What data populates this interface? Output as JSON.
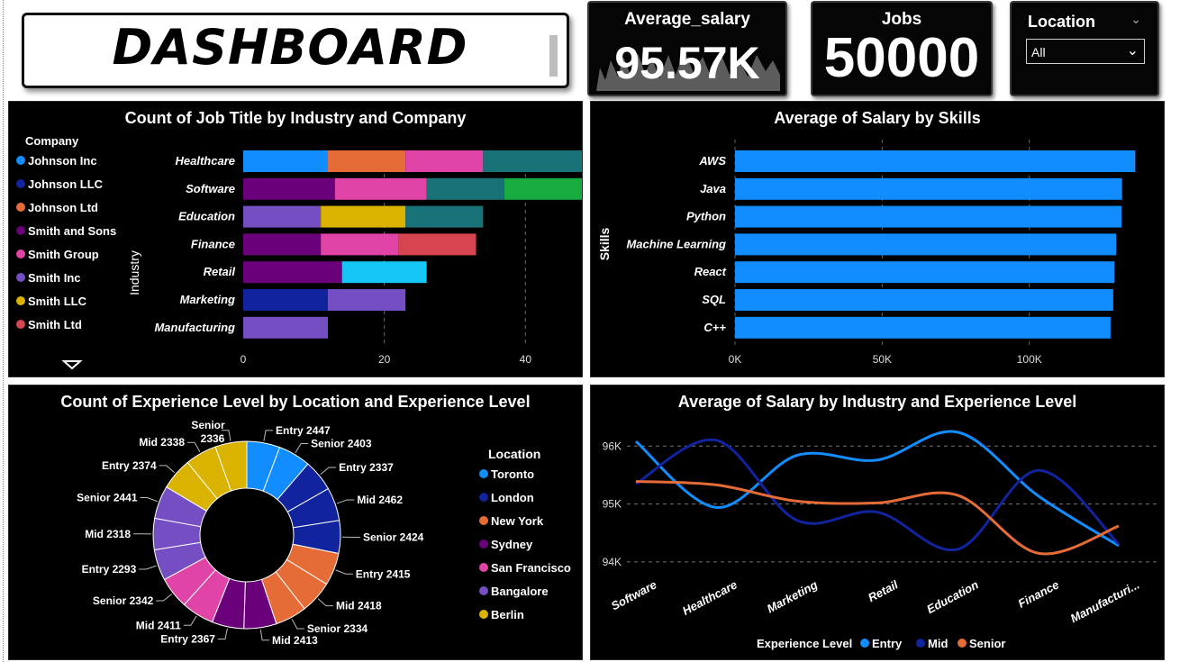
{
  "header": {
    "title": "DASHBOARD"
  },
  "kpi_salary": {
    "label": "Average_salary",
    "value": "95.57K"
  },
  "kpi_jobs": {
    "label": "Jobs",
    "value": "50000"
  },
  "location_slicer": {
    "title": "Location",
    "selected": "All"
  },
  "colors": {
    "company": [
      "#118DFF",
      "#12239E",
      "#E66C37",
      "#6B007B",
      "#E044A7",
      "#744EC2",
      "#D9B300",
      "#D64550"
    ],
    "location": [
      "#118DFF",
      "#12239E",
      "#E66C37",
      "#6B007B",
      "#E044A7",
      "#744EC2",
      "#D9B300"
    ],
    "accent": "#118DFF"
  },
  "chart_data": [
    {
      "type": "bar",
      "title": "Count of Job Title by Industry and Company",
      "ylabel": "Industry",
      "legend_title": "Company",
      "legend": [
        "Johnson Inc",
        "Johnson LLC",
        "Johnson Ltd",
        "Smith and Sons",
        "Smith Group",
        "Smith Inc",
        "Smith LLC",
        "Smith Ltd"
      ],
      "categories": [
        "Healthcare",
        "Software",
        "Education",
        "Finance",
        "Retail",
        "Marketing",
        "Manufacturing"
      ],
      "stacks": [
        [
          {
            "c": 0,
            "v": 12
          },
          {
            "c": 2,
            "v": 11
          },
          {
            "c": 4,
            "v": 11
          },
          {
            "c": 8,
            "v": 14
          }
        ],
        [
          {
            "c": 3,
            "v": 13
          },
          {
            "c": 4,
            "v": 13
          },
          {
            "c": 8,
            "v": 11
          },
          {
            "c": 9,
            "v": 11
          }
        ],
        [
          {
            "c": 5,
            "v": 11
          },
          {
            "c": 6,
            "v": 12
          },
          {
            "c": 8,
            "v": 11
          }
        ],
        [
          {
            "c": 3,
            "v": 11
          },
          {
            "c": 4,
            "v": 11
          },
          {
            "c": 7,
            "v": 11
          }
        ],
        [
          {
            "c": 3,
            "v": 14
          },
          {
            "c": 10,
            "v": 12
          }
        ],
        [
          {
            "c": 1,
            "v": 12
          },
          {
            "c": 5,
            "v": 11
          }
        ],
        [
          {
            "c": 5,
            "v": 12
          }
        ]
      ],
      "xlim": [
        0,
        48
      ],
      "xticks": [
        "0",
        "20",
        "40"
      ],
      "grid": true
    },
    {
      "type": "bar",
      "title": "Average of Salary by Skills",
      "ylabel": "Skills",
      "categories": [
        "AWS",
        "Java",
        "Python",
        "Machine Learning",
        "React",
        "SQL",
        "C++"
      ],
      "values": [
        136000,
        131500,
        131300,
        129500,
        128900,
        128500,
        127600
      ],
      "xlim": [
        0,
        136500
      ],
      "xticks": [
        "0K",
        "50K",
        "100K"
      ],
      "grid": true
    },
    {
      "type": "pie",
      "title": "Count of Experience Level by Location and Experience Level",
      "legend_title": "Location",
      "legend": [
        "Toronto",
        "London",
        "New York",
        "Sydney",
        "San Francisco",
        "Bangalore",
        "Berlin"
      ],
      "slices": [
        {
          "label": "Entry 2447",
          "value": 2447,
          "loc": 0
        },
        {
          "label": "Senior 2403",
          "value": 2403,
          "loc": 0
        },
        {
          "label": "Entry 2337",
          "value": 2337,
          "loc": 1
        },
        {
          "label": "Mid 2462",
          "value": 2462,
          "loc": 1
        },
        {
          "label": "Senior 2424",
          "value": 2424,
          "loc": 1
        },
        {
          "label": "Entry 2415",
          "value": 2415,
          "loc": 2
        },
        {
          "label": "Mid 2418",
          "value": 2418,
          "loc": 2
        },
        {
          "label": "Senior 2334",
          "value": 2334,
          "loc": 2
        },
        {
          "label": "Mid 2413",
          "value": 2413,
          "loc": 3
        },
        {
          "label": "Entry 2367",
          "value": 2367,
          "loc": 3
        },
        {
          "label": "Mid 2411",
          "value": 2411,
          "loc": 4
        },
        {
          "label": "Senior 2342",
          "value": 2342,
          "loc": 4
        },
        {
          "label": "Entry 2293",
          "value": 2293,
          "loc": 5
        },
        {
          "label": "Mid 2318",
          "value": 2318,
          "loc": 5
        },
        {
          "label": "Senior 2441",
          "value": 2441,
          "loc": 5
        },
        {
          "label": "Entry 2374",
          "value": 2374,
          "loc": 6
        },
        {
          "label": "Mid 2338",
          "value": 2338,
          "loc": 6
        },
        {
          "label": "Senior 2336",
          "value": 2336,
          "loc": 6
        }
      ]
    },
    {
      "type": "line",
      "title": "Average of Salary by Industry and Experience Level",
      "legend_title": "Experience Level",
      "categories": [
        "Software",
        "Healthcare",
        "Marketing",
        "Retail",
        "Education",
        "Finance",
        "Manufacturi..."
      ],
      "series": [
        {
          "name": "Entry",
          "color": "#118DFF",
          "values": [
            96080,
            94940,
            95840,
            95760,
            96240,
            95140,
            94280
          ]
        },
        {
          "name": "Mid",
          "color": "#12239E",
          "values": [
            95350,
            96100,
            94720,
            94860,
            94220,
            95580,
            94310
          ]
        },
        {
          "name": "Senior",
          "color": "#E66C37",
          "values": [
            95390,
            95330,
            95050,
            95020,
            95150,
            94150,
            94620
          ]
        }
      ],
      "ylim": [
        93750,
        96300
      ],
      "yticks": [
        {
          "v": 96000,
          "t": "96K"
        },
        {
          "v": 95000,
          "t": "95K"
        },
        {
          "v": 94000,
          "t": "94K"
        }
      ],
      "grid": true
    }
  ]
}
